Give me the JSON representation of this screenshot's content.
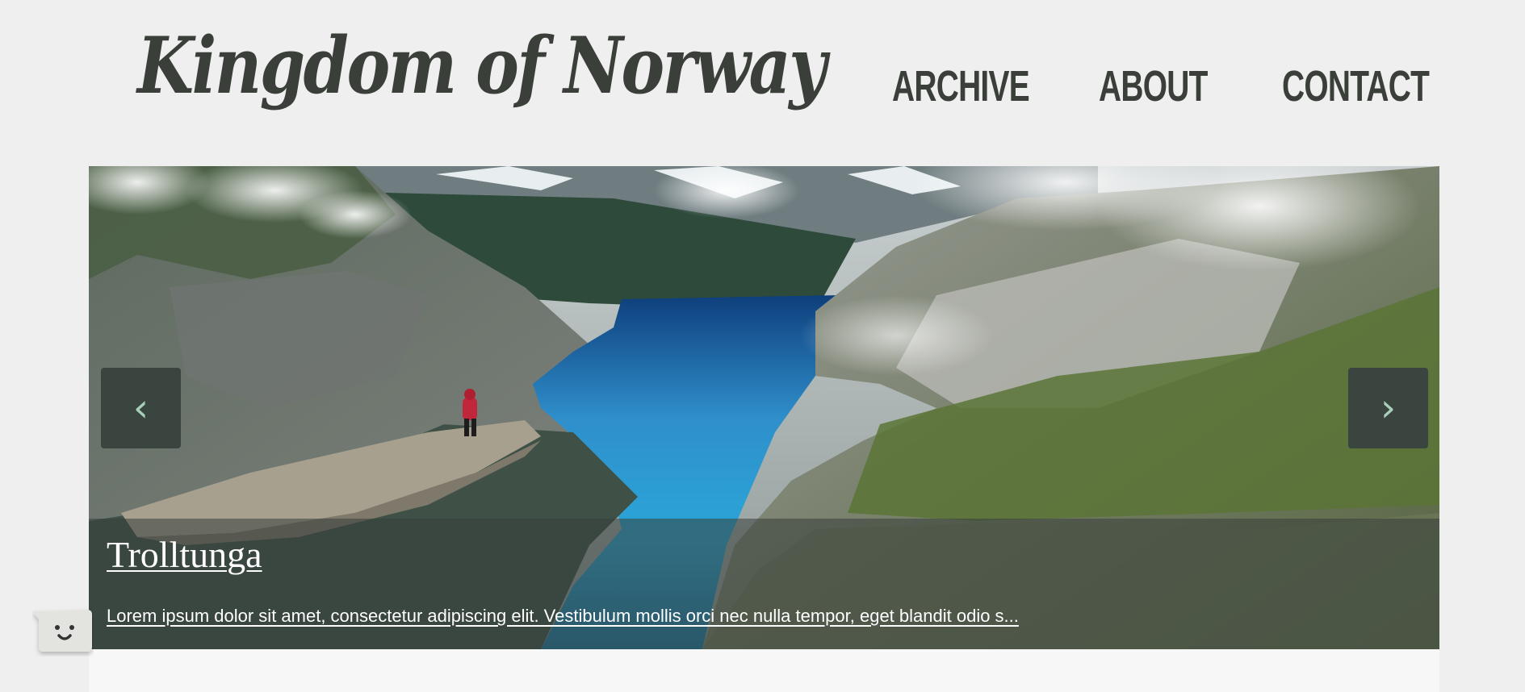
{
  "header": {
    "site_title": "Kingdom of Norway"
  },
  "nav": {
    "items": [
      {
        "label": "ARCHIVE"
      },
      {
        "label": "ABOUT"
      },
      {
        "label": "CONTACT"
      }
    ]
  },
  "carousel": {
    "prev_label": "‹",
    "next_label": "›",
    "slide": {
      "title": "Trolltunga",
      "excerpt": "Lorem ipsum dolor sit amet, consectetur adipiscing elit. Vestibulum mollis orci nec nulla tempor, eget blandit odio s..."
    }
  },
  "chat_widget": {
    "icon": "smiley-face-icon"
  },
  "colors": {
    "background": "#efefef",
    "text_dark": "#3b3f3a",
    "carousel_button": "#3b4540",
    "carousel_arrow": "#a8d0b8"
  }
}
